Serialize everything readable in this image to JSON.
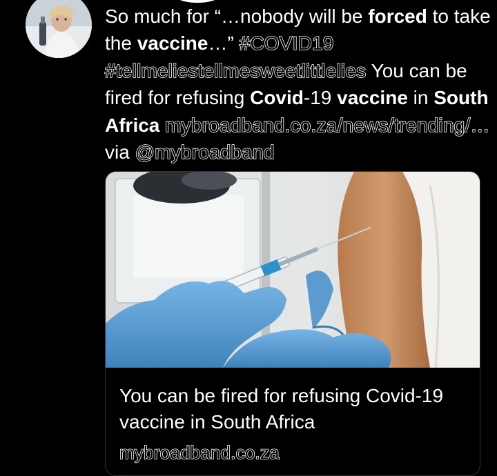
{
  "tweet": {
    "segments": [
      {
        "text": "So much for “…nobody will be ",
        "style": "normal"
      },
      {
        "text": "forced",
        "style": "bold"
      },
      {
        "text": " to take the ",
        "style": "normal"
      },
      {
        "text": "vaccine",
        "style": "bold"
      },
      {
        "text": "…” ",
        "style": "normal"
      },
      {
        "text": "#COVID19",
        "style": "link"
      },
      {
        "text": " ",
        "style": "normal"
      },
      {
        "text": "#tellmeliestellmesweetlittlelies",
        "style": "link"
      },
      {
        "text": " You can be fired for refusing ",
        "style": "normal"
      },
      {
        "text": "Covid",
        "style": "bold"
      },
      {
        "text": "-19 ",
        "style": "normal"
      },
      {
        "text": "vaccine",
        "style": "bold"
      },
      {
        "text": " in ",
        "style": "normal"
      },
      {
        "text": "South Africa",
        "style": "bold"
      },
      {
        "text": " ",
        "style": "normal"
      },
      {
        "text": "mybroadband.co.za/news/trending/…",
        "style": "link"
      },
      {
        "text": " via ",
        "style": "normal"
      },
      {
        "text": "@mybroadband",
        "style": "link"
      }
    ]
  },
  "card": {
    "title": "You can be fired for refusing Covid-19 vaccine in South Africa",
    "domain": "mybroadband.co.za"
  },
  "colors": {
    "background": "#000000",
    "text": "#ffffff",
    "card_border": "#2f3336",
    "glove": "#5b9bd0"
  }
}
